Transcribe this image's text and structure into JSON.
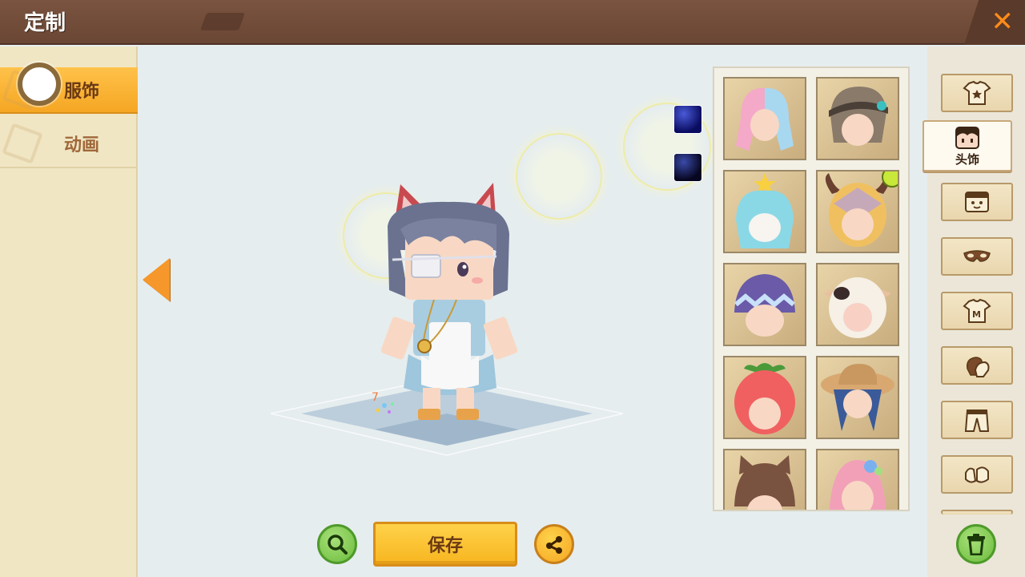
{
  "header": {
    "title": "定制"
  },
  "left_tabs": [
    {
      "label": "服饰",
      "active": true
    },
    {
      "label": "动画",
      "active": false
    }
  ],
  "actions": {
    "save_label": "保存"
  },
  "categories": [
    {
      "icon": "shirt-star-icon"
    },
    {
      "icon": "head-accessory-icon",
      "label": "头饰",
      "active": true
    },
    {
      "icon": "face-icon"
    },
    {
      "icon": "mask-icon"
    },
    {
      "icon": "shirt-m-icon"
    },
    {
      "icon": "gloves-icon"
    },
    {
      "icon": "pants-icon"
    },
    {
      "icon": "shoes-icon"
    }
  ],
  "items": [
    {
      "name": "pastel-braided-hair",
      "color": "#f4a9c8"
    },
    {
      "name": "brown-cap-hair",
      "color": "#7a6a5a"
    },
    {
      "name": "cake-crown-hair",
      "color": "#8ad8e6"
    },
    {
      "name": "horned-egg-hood",
      "color": "#f0c060",
      "timed": true
    },
    {
      "name": "purple-zigzag-helmet",
      "color": "#6a5aa8"
    },
    {
      "name": "cow-hood",
      "color": "#f6f0e6"
    },
    {
      "name": "tomato-hat",
      "color": "#f06060"
    },
    {
      "name": "straw-hat-blue-hair",
      "color": "#3a5a9a"
    },
    {
      "name": "cat-ear-brown-hair",
      "color": "#7a5240"
    },
    {
      "name": "pink-flower-hair",
      "color": "#f2a0b8"
    }
  ],
  "colors": {
    "accent": "#f5a623",
    "header": "#6e4a38",
    "confirm": "#6cbc3c"
  }
}
